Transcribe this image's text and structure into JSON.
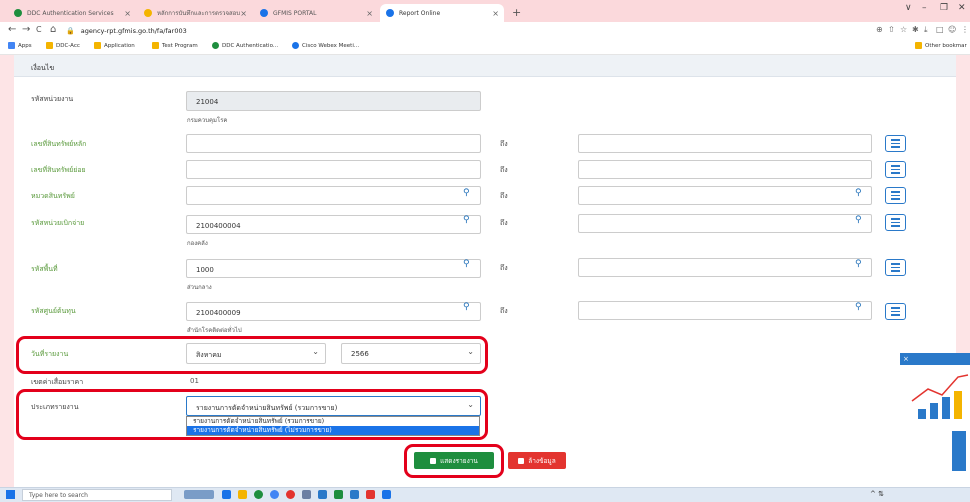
{
  "browser": {
    "tabs": [
      {
        "label": "DDC Authentication Services",
        "color": "#1e8e3e"
      },
      {
        "label": "หลักการบันทึกและการตรวจสอบ",
        "color": "#f4b400"
      },
      {
        "label": "GFMIS PORTAL",
        "color": "#1a73e8"
      },
      {
        "label": "Report Online",
        "color": "#1a73e8"
      }
    ],
    "tab_close": "×",
    "new_tab": "+",
    "window_controls": [
      "∨",
      "–",
      "❐",
      "✕"
    ],
    "nav_buttons": [
      "←",
      "→",
      "C",
      "⌂"
    ],
    "url": "agency-rpt.gfmis.go.th/fa/far003",
    "right_icons": [
      "⊕",
      "⇧",
      "☆",
      "✱",
      "⤓",
      "□",
      "☺",
      "⋮"
    ],
    "bookmarks": [
      {
        "label": "Apps",
        "color": "#4285f4"
      },
      {
        "label": "DDC-Acc",
        "color": "#f4b400"
      },
      {
        "label": "Application",
        "color": "#f4b400"
      },
      {
        "label": "Test Program",
        "color": "#f4b400"
      },
      {
        "label": "DDC Authenticatio...",
        "color": "#1e8e3e"
      },
      {
        "label": "Cisco Webex Meeti...",
        "color": "#1a73e8"
      }
    ],
    "other_bookmarks": "Other bookmar"
  },
  "form": {
    "title": "เงื่อนไข",
    "to_label": "ถึง",
    "agency_code": {
      "label": "รหัสหน่วยงาน",
      "value": "21004",
      "subtitle": "กรมควบคุมโรค"
    },
    "main_asset_no": {
      "label": "เลขที่สินทรัพย์หลัก"
    },
    "sub_asset_no": {
      "label": "เลขที่สินทรัพย์ย่อย"
    },
    "asset_category": {
      "label": "หมวดสินทรัพย์"
    },
    "disbursing_unit": {
      "label": "รหัสหน่วยเบิกจ่าย",
      "value": "2100400004",
      "subtitle": "กองคลัง"
    },
    "area_code": {
      "label": "รหัสพื้นที่",
      "value": "1000",
      "subtitle": "ส่วนกลาง"
    },
    "cost_center": {
      "label": "รหัสศูนย์ต้นทุน",
      "value": "2100400009",
      "subtitle": "สำนักโรคติดต่อทั่วไป"
    },
    "report_date": {
      "label": "วันที่รายงาน",
      "month": "สิงหาคม",
      "year": "2566"
    },
    "depreciation_area": {
      "label": "เขตค่าเสื่อมราคา",
      "value": "01"
    },
    "report_type": {
      "label": "ประเภทรายงาน",
      "value": "รายงานการตัดจำหน่ายสินทรัพย์ (รวมการขาย)",
      "options": [
        "รายงานการตัดจำหน่ายสินทรัพย์ (รวมการขาย)",
        "รายงานการตัดจำหน่ายสินทรัพย์ (ไม่รวมการขาย)"
      ]
    },
    "show_report_button": "แสดงรายงาน",
    "clear_button": "ล้างข้อมูล"
  },
  "taskbar": {
    "search_placeholder": "Type here to search",
    "tray": "^ ⇅"
  },
  "colors": {
    "green_label": "#5a9a3c",
    "highlight_red": "#e3001b",
    "primary_blue": "#2a79c9",
    "show_button": "#1e8e3e",
    "clear_button": "#e3342f"
  }
}
